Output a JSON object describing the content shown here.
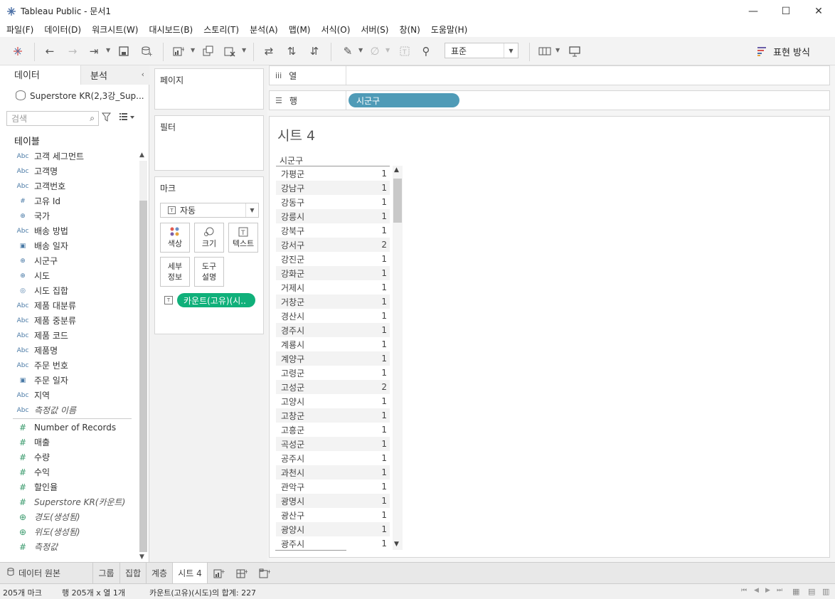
{
  "window": {
    "title": "Tableau Public - 문서1",
    "minimize": "—",
    "maximize": "☐",
    "close": "✕"
  },
  "menu": [
    "파일(F)",
    "데이터(D)",
    "워크시트(W)",
    "대시보드(B)",
    "스토리(T)",
    "분석(A)",
    "맵(M)",
    "서식(O)",
    "서버(S)",
    "창(N)",
    "도움말(H)"
  ],
  "toolbar": {
    "fit": "표준",
    "show_me": "표현 방식"
  },
  "data_pane": {
    "tab_data": "데이터",
    "tab_analysis": "분석",
    "collapse": "‹",
    "datasource": "Superstore KR(2,3강_Sup...",
    "search_placeholder": "검색",
    "section": "테이블",
    "dimensions": [
      {
        "type": "Abc",
        "label": "고객 세그먼트"
      },
      {
        "type": "Abc",
        "label": "고객명"
      },
      {
        "type": "Abc",
        "label": "고객번호"
      },
      {
        "type": "#",
        "label": "고유 Id"
      },
      {
        "type": "globe",
        "label": "국가"
      },
      {
        "type": "Abc",
        "label": "배송 방법"
      },
      {
        "type": "date",
        "label": "배송 일자"
      },
      {
        "type": "globe",
        "label": "시군구"
      },
      {
        "type": "globe",
        "label": "시도"
      },
      {
        "type": "set",
        "label": "시도 집합"
      },
      {
        "type": "Abc",
        "label": "제품 대분류"
      },
      {
        "type": "Abc",
        "label": "제품 중분류"
      },
      {
        "type": "Abc",
        "label": "제품 코드"
      },
      {
        "type": "Abc",
        "label": "제품명"
      },
      {
        "type": "Abc",
        "label": "주문 번호"
      },
      {
        "type": "date",
        "label": "주문 일자"
      },
      {
        "type": "Abc",
        "label": "지역"
      },
      {
        "type": "Abc",
        "label": "측정값 이름",
        "italic": true
      }
    ],
    "measures": [
      {
        "type": "#",
        "label": "Number of Records"
      },
      {
        "type": "#",
        "label": "매출"
      },
      {
        "type": "#",
        "label": "수량"
      },
      {
        "type": "#",
        "label": "수익"
      },
      {
        "type": "#",
        "label": "할인율"
      },
      {
        "type": "#",
        "label": "Superstore KR(카운트)",
        "italic": true
      },
      {
        "type": "globe",
        "label": "경도(생성됨)",
        "italic": true
      },
      {
        "type": "globe",
        "label": "위도(생성됨)",
        "italic": true
      },
      {
        "type": "#",
        "label": "측정값",
        "italic": true
      }
    ]
  },
  "shelves": {
    "pages": "페이지",
    "filters": "필터",
    "marks": "마크",
    "mark_type": "자동",
    "color": "색상",
    "size": "크기",
    "text": "텍스트",
    "detail_1": "세부",
    "detail_2": "정보",
    "tooltip_1": "도구",
    "tooltip_2": "설명",
    "mark_pill": "카운트(고유)(시..",
    "columns": "열",
    "rows": "행",
    "rows_pill": "시군구"
  },
  "view": {
    "sheet_title": "시트 4",
    "column_header": "시군구",
    "rows": [
      {
        "name": "가평군",
        "value": "1"
      },
      {
        "name": "강남구",
        "value": "1"
      },
      {
        "name": "강동구",
        "value": "1"
      },
      {
        "name": "강릉시",
        "value": "1"
      },
      {
        "name": "강북구",
        "value": "1"
      },
      {
        "name": "강서구",
        "value": "2"
      },
      {
        "name": "강진군",
        "value": "1"
      },
      {
        "name": "강화군",
        "value": "1"
      },
      {
        "name": "거제시",
        "value": "1"
      },
      {
        "name": "거창군",
        "value": "1"
      },
      {
        "name": "경산시",
        "value": "1"
      },
      {
        "name": "경주시",
        "value": "1"
      },
      {
        "name": "계룡시",
        "value": "1"
      },
      {
        "name": "계양구",
        "value": "1"
      },
      {
        "name": "고령군",
        "value": "1"
      },
      {
        "name": "고성군",
        "value": "2"
      },
      {
        "name": "고양시",
        "value": "1"
      },
      {
        "name": "고창군",
        "value": "1"
      },
      {
        "name": "고흥군",
        "value": "1"
      },
      {
        "name": "곡성군",
        "value": "1"
      },
      {
        "name": "공주시",
        "value": "1"
      },
      {
        "name": "과천시",
        "value": "1"
      },
      {
        "name": "관악구",
        "value": "1"
      },
      {
        "name": "광명시",
        "value": "1"
      },
      {
        "name": "광산구",
        "value": "1"
      },
      {
        "name": "광양시",
        "value": "1"
      },
      {
        "name": "광주시",
        "value": "1"
      }
    ]
  },
  "bottom_tabs": {
    "datasource": "데이터 원본",
    "t1": "그룹",
    "t2": "집합",
    "t3": "계층",
    "active": "시트 4"
  },
  "status": {
    "marks": "205개 마크",
    "rows_cols": "행 205개 x 열 1개",
    "sum": "카운트(고유)(시도)의 합계: 227"
  },
  "colors": {
    "row_pill": "#4f9bb7",
    "measure_pill": "#10b07a",
    "dimension_icon": "#4a7aa6",
    "measure_icon": "#3a9a6c"
  }
}
